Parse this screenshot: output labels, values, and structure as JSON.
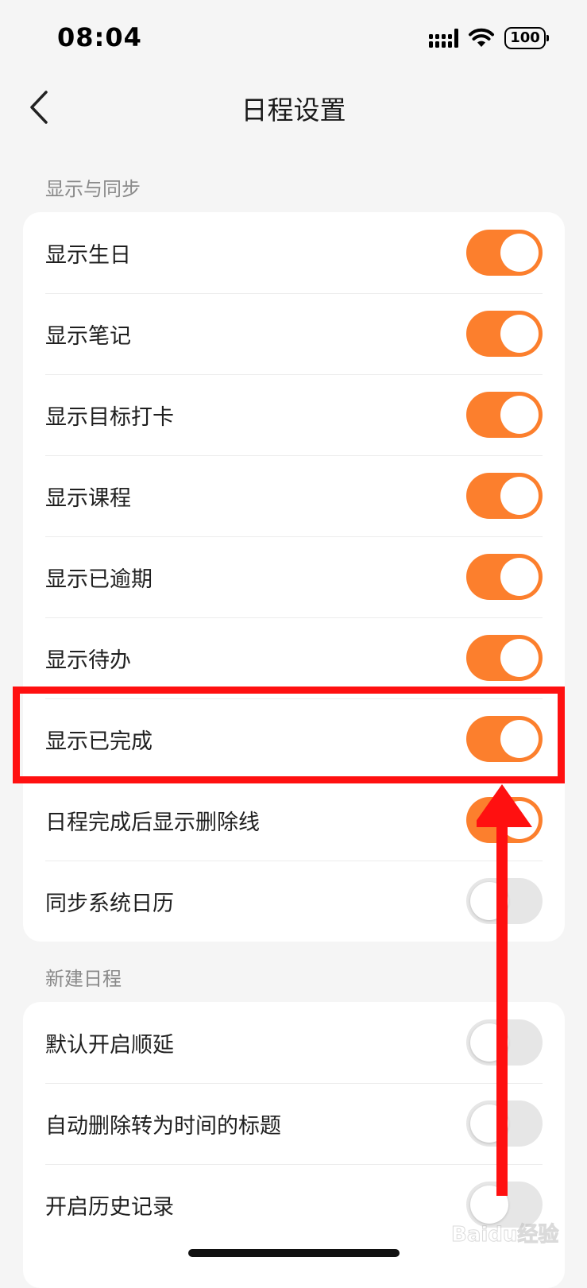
{
  "status_bar": {
    "time": "08:04",
    "battery": "100",
    "signal_icon": "cellular-signal-icon",
    "wifi_icon": "wifi-icon"
  },
  "header": {
    "title": "日程设置",
    "back_icon": "chevron-left-icon"
  },
  "sections": [
    {
      "label": "显示与同步",
      "items": [
        {
          "label": "显示生日",
          "enabled": true
        },
        {
          "label": "显示笔记",
          "enabled": true
        },
        {
          "label": "显示目标打卡",
          "enabled": true
        },
        {
          "label": "显示课程",
          "enabled": true
        },
        {
          "label": "显示已逾期",
          "enabled": true
        },
        {
          "label": "显示待办",
          "enabled": true
        },
        {
          "label": "显示已完成",
          "enabled": true
        },
        {
          "label": "日程完成后显示删除线",
          "enabled": true
        },
        {
          "label": "同步系统日历",
          "enabled": false
        }
      ]
    },
    {
      "label": "新建日程",
      "items": [
        {
          "label": "默认开启顺延",
          "enabled": false
        },
        {
          "label": "自动删除转为时间的标题",
          "enabled": false
        },
        {
          "label": "开启历史记录",
          "enabled": false
        }
      ]
    }
  ],
  "colors": {
    "accent": "#fc7f2d",
    "toggle_off": "#e6e6e6",
    "annotation": "#ff1010",
    "background": "#f5f5f5"
  },
  "watermark": {
    "text": "Baidu经验"
  }
}
